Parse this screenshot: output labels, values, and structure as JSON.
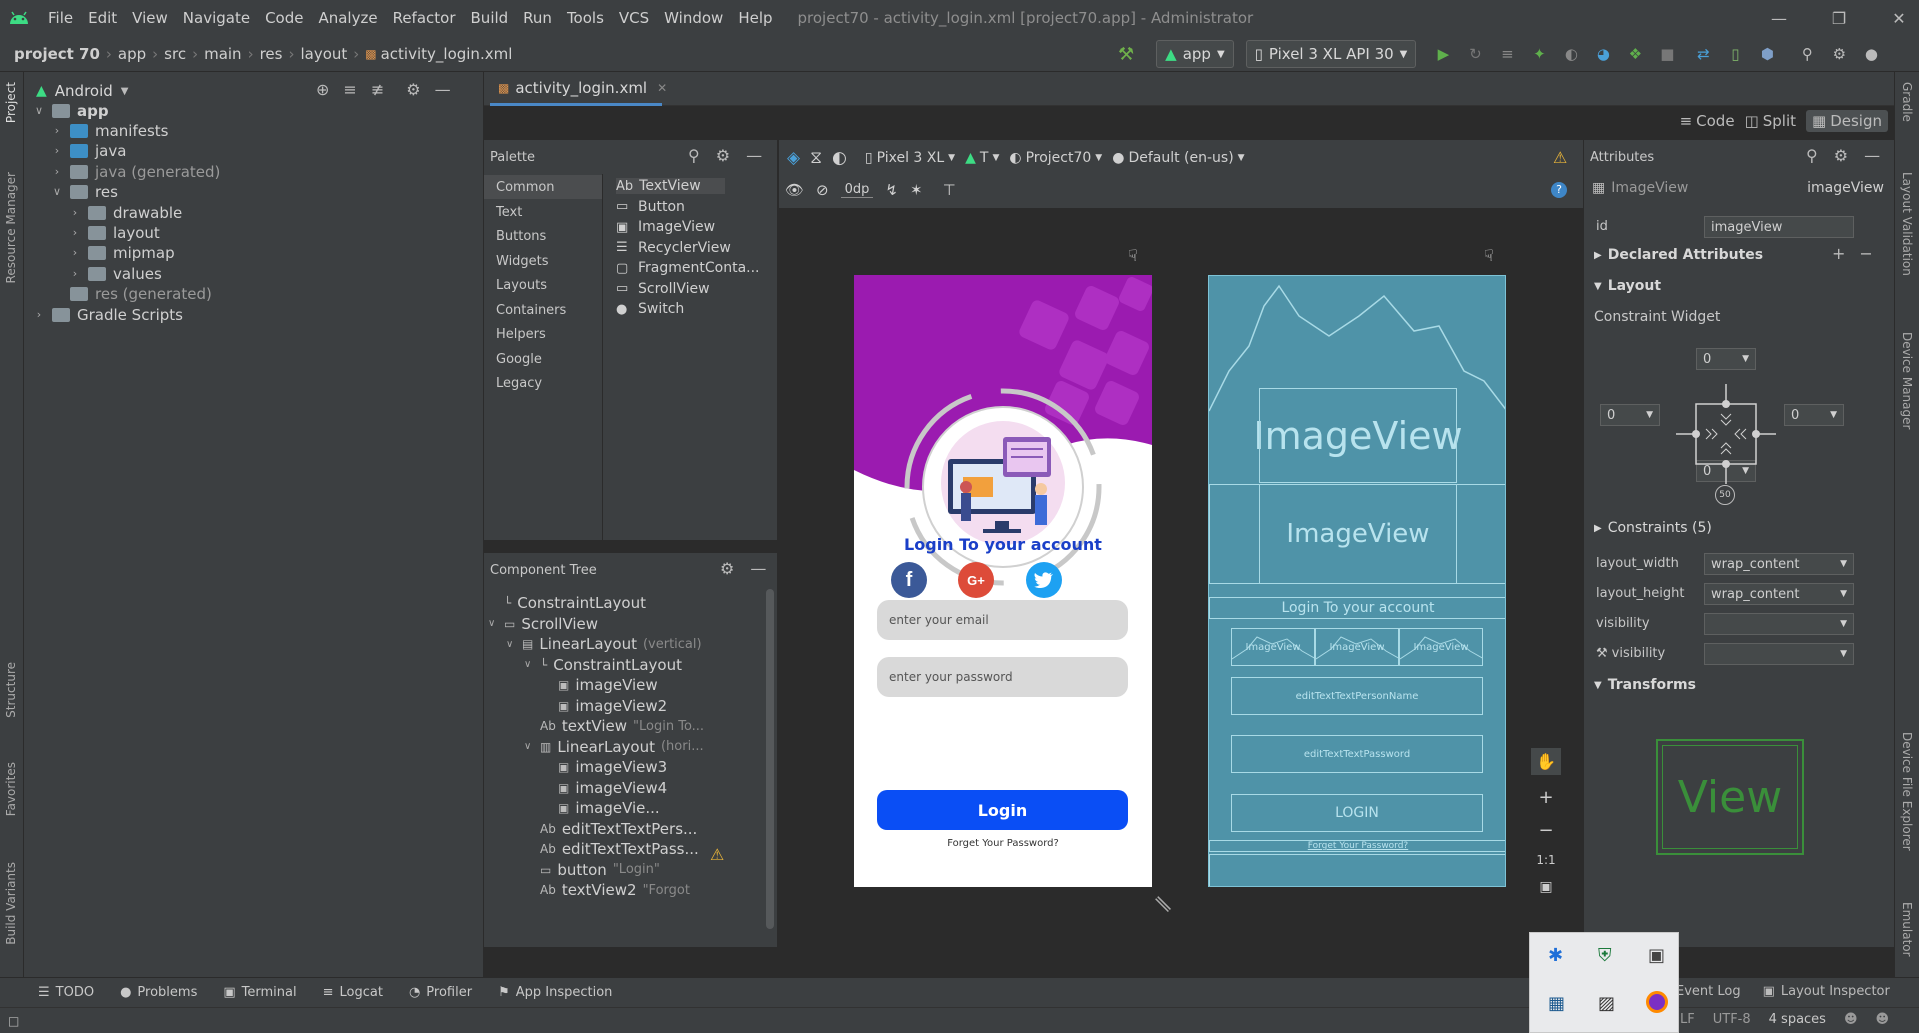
{
  "menubar": {
    "items": [
      "File",
      "Edit",
      "View",
      "Navigate",
      "Code",
      "Analyze",
      "Refactor",
      "Build",
      "Run",
      "Tools",
      "VCS",
      "Window",
      "Help"
    ],
    "window_title": "project70 - activity_login.xml [project70.app] - Administrator"
  },
  "breadcrumb": {
    "items": [
      "project 70",
      "app",
      "src",
      "main",
      "res",
      "layout",
      "activity_login.xml"
    ]
  },
  "toolbar": {
    "run_config": "app",
    "device": "Pixel 3 XL API 30"
  },
  "project_panel": {
    "view_selector": "Android",
    "tree": [
      {
        "label": "app",
        "level": 0,
        "expanded": true
      },
      {
        "label": "manifests",
        "level": 1
      },
      {
        "label": "java",
        "level": 1
      },
      {
        "label": "java (generated)",
        "level": 1
      },
      {
        "label": "res",
        "level": 1,
        "expanded": true
      },
      {
        "label": "drawable",
        "level": 2
      },
      {
        "label": "layout",
        "level": 2
      },
      {
        "label": "mipmap",
        "level": 2
      },
      {
        "label": "values",
        "level": 2
      },
      {
        "label": "res (generated)",
        "level": 1
      },
      {
        "label": "Gradle Scripts",
        "level": 0
      }
    ]
  },
  "left_strip": {
    "project": "Project",
    "resource_manager": "Resource Manager",
    "structure": "Structure",
    "favorites": "Favorites",
    "build_variants": "Build Variants"
  },
  "right_strip": {
    "gradle": "Gradle",
    "layout_validation": "Layout Validation",
    "device_manager": "Device Manager",
    "device_file_explorer": "Device File Explorer",
    "emulator": "Emulator"
  },
  "editor": {
    "tab": "activity_login.xml",
    "view_modes": [
      "Code",
      "Split",
      "Design"
    ]
  },
  "palette": {
    "title": "Palette",
    "categories": [
      "Common",
      "Text",
      "Buttons",
      "Widgets",
      "Layouts",
      "Containers",
      "Helpers",
      "Google",
      "Legacy"
    ],
    "items": [
      "TextView",
      "Button",
      "ImageView",
      "RecyclerView",
      "FragmentConta...",
      "ScrollView",
      "Switch"
    ],
    "textview_prefix": "Ab"
  },
  "component_tree": {
    "title": "Component Tree",
    "nodes": [
      {
        "label": "ConstraintLayout",
        "hint": ""
      },
      {
        "label": "ScrollView",
        "hint": ""
      },
      {
        "label": "LinearLayout",
        "hint": "(vertical)"
      },
      {
        "label": "ConstraintLayout",
        "hint": ""
      },
      {
        "label": "imageView",
        "hint": ""
      },
      {
        "label": "imageView2",
        "hint": ""
      },
      {
        "label": "textView",
        "hint": "\"Login To..."
      },
      {
        "label": "LinearLayout",
        "hint": "(hori..."
      },
      {
        "label": "imageView3",
        "hint": ""
      },
      {
        "label": "imageView4",
        "hint": ""
      },
      {
        "label": "imageVie...",
        "hint": ""
      },
      {
        "label": "editTextTextPers...",
        "hint": ""
      },
      {
        "label": "editTextTextPass...",
        "hint": ""
      },
      {
        "label": "button",
        "hint": "\"Login\""
      },
      {
        "label": "textView2",
        "hint": "\"Forgot"
      }
    ]
  },
  "design_toolbar": {
    "device": "Pixel 3 XL",
    "api": "T",
    "theme": "Project70",
    "locale": "Default (en-us)",
    "margin": "0dp"
  },
  "preview": {
    "heading": "Login To your account",
    "email_placeholder": "enter your email",
    "password_placeholder": "enter your password",
    "login_button": "Login",
    "forgot_password": "Forget Your Password?",
    "social_icons": [
      "facebook-icon",
      "google-plus-icon",
      "twitter-icon"
    ],
    "social_letters": [
      "f",
      "G+",
      ""
    ],
    "colors": {
      "header_purple": "#9b1bb0",
      "button_blue": "#0a4ef5",
      "facebook": "#3b5998",
      "google": "#dd4b39",
      "twitter": "#1da1f2"
    }
  },
  "blueprint": {
    "image_view_1": "ImageView",
    "image_view_2": "ImageView",
    "heading": "Login To your account",
    "small_images": [
      "ImageView",
      "ImageView",
      "ImageView"
    ],
    "name_field": "editTextTextPersonName",
    "password_field": "editTextTextPassword",
    "login": "LOGIN",
    "forgot": "Forget Your Password?"
  },
  "zoom_controls": {
    "one_to_one": "1:1"
  },
  "attributes": {
    "title": "Attributes",
    "component_type": "ImageView",
    "component_id": "imageView",
    "id_label": "id",
    "id_value": "imageView",
    "declared_attributes": "Declared Attributes",
    "layout_section": "Layout",
    "constraint_widget": "Constraint Widget",
    "constraint_values": {
      "top": "0",
      "left": "0",
      "right": "0",
      "bottom": "0",
      "bias": "50"
    },
    "constraints": "Constraints (5)",
    "layout_width_label": "layout_width",
    "layout_width": "wrap_content",
    "layout_height_label": "layout_height",
    "layout_height": "wrap_content",
    "visibility_label": "visibility",
    "visibility2_label": "visibility",
    "transforms": "Transforms",
    "view_preview": "View"
  },
  "bottom_tabs": [
    "TODO",
    "Problems",
    "Terminal",
    "Logcat",
    "Profiler",
    "App Inspection"
  ],
  "bottom_right_tabs": [
    "Event Log",
    "Layout Inspector"
  ],
  "status": {
    "line_sep": "LF",
    "encoding": "UTF-8",
    "indent": "4 spaces"
  }
}
